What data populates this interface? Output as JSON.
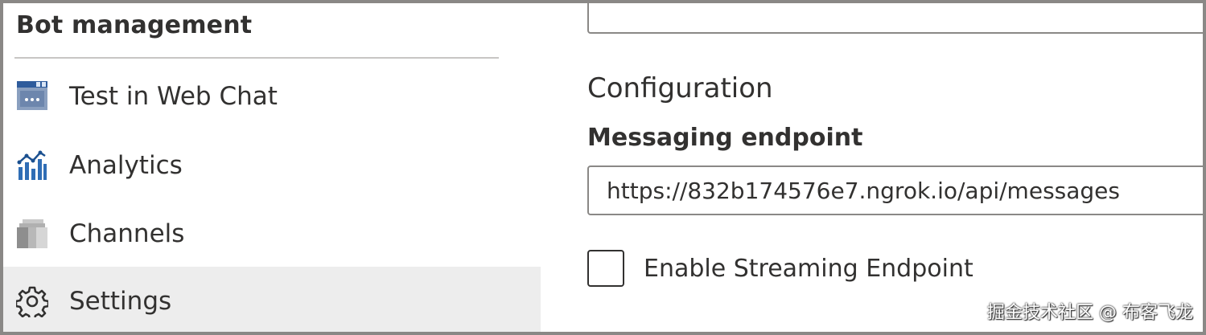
{
  "sidebar": {
    "section_title": "Bot management",
    "items": [
      {
        "label": "Test in Web Chat",
        "icon": "web-chat-icon"
      },
      {
        "label": "Analytics",
        "icon": "analytics-icon"
      },
      {
        "label": "Channels",
        "icon": "channels-icon"
      },
      {
        "label": "Settings",
        "icon": "gear-icon",
        "selected": true
      }
    ]
  },
  "main": {
    "top_input_value": "",
    "configuration_title": "Configuration",
    "messaging_endpoint": {
      "label": "Messaging endpoint",
      "value": "https://832b174576e7.ngrok.io/api/messages"
    },
    "streaming_checkbox": {
      "label": "Enable Streaming Endpoint",
      "checked": false
    }
  },
  "watermark": "掘金技术社区 @ 布客飞龙",
  "colors": {
    "selected_bg": "#ededed",
    "border": "#8a8886",
    "text": "#323130",
    "icon_blue": "#0078d4"
  }
}
